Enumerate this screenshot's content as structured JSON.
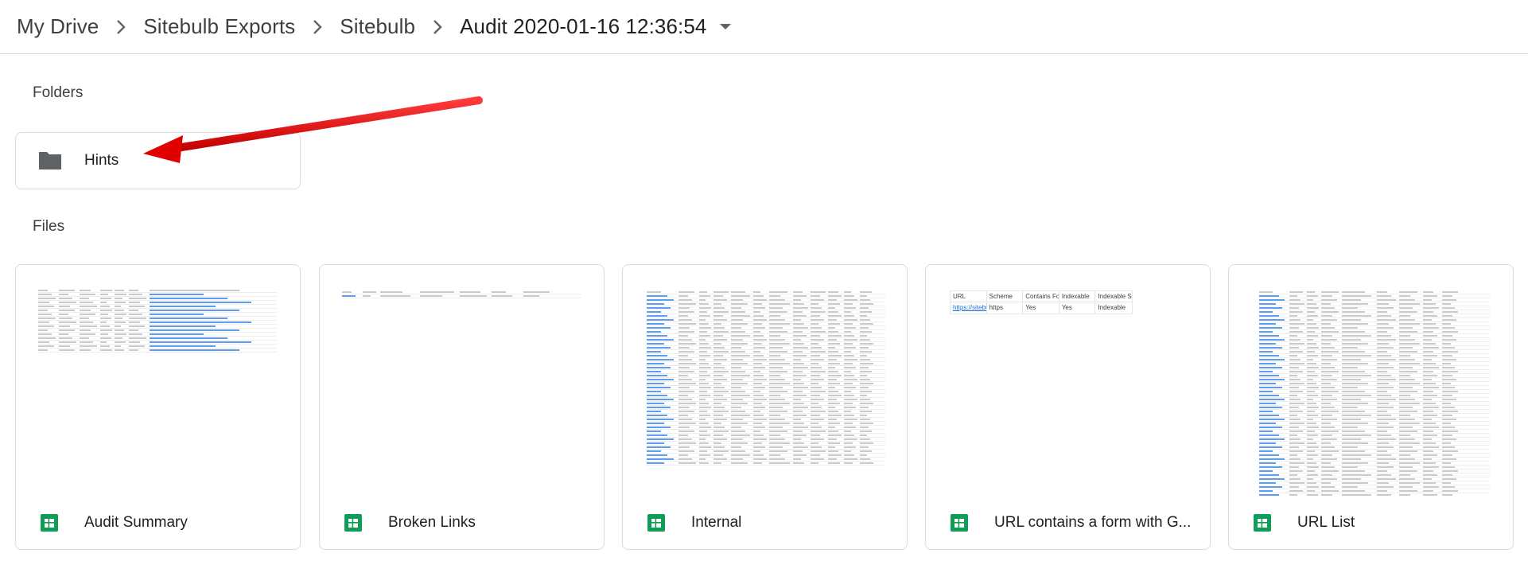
{
  "breadcrumb": {
    "items": [
      "My Drive",
      "Sitebulb Exports",
      "Sitebulb",
      "Audit 2020-01-16 12:36:54"
    ]
  },
  "sections": {
    "folders_label": "Folders",
    "files_label": "Files"
  },
  "folders": [
    {
      "name": "Hints",
      "icon": "folder-icon"
    }
  ],
  "files": [
    {
      "name": "Audit Summary",
      "icon": "google-sheets-icon"
    },
    {
      "name": "Broken Links",
      "icon": "google-sheets-icon"
    },
    {
      "name": "Internal",
      "icon": "google-sheets-icon"
    },
    {
      "name": "URL contains a form with G...",
      "icon": "google-sheets-icon"
    },
    {
      "name": "URL List",
      "icon": "google-sheets-icon"
    }
  ],
  "previews": {
    "url_form_sheet": {
      "headers": [
        "URL",
        "Scheme",
        "Contains Form w",
        "Indexable",
        "Indexable Status"
      ],
      "row": [
        "https://sitebulb.co",
        "https",
        "Yes",
        "Yes",
        "Indexable"
      ]
    }
  },
  "colors": {
    "sheets_green": "#0f9d58",
    "arrow_red": "#e00000",
    "icon_grey": "#5f6368",
    "border": "#dadce0"
  }
}
